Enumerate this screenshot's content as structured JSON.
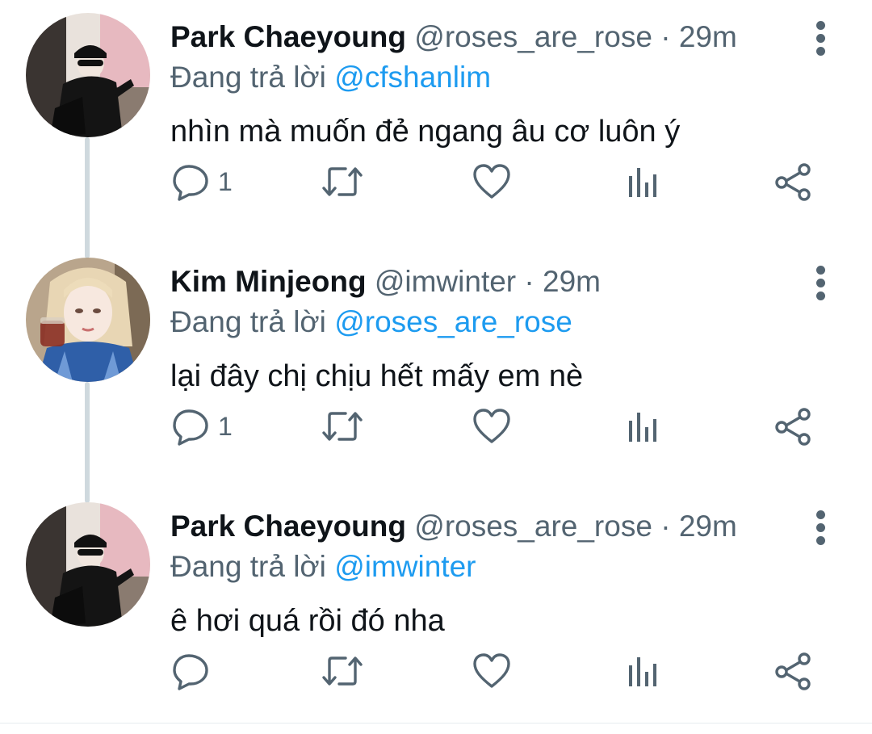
{
  "thread": [
    {
      "display_name": "Park Chaeyoung",
      "handle": "@roses_are_rose",
      "separator": "·",
      "time": "29m",
      "reply_prefix": "Đang trả lời",
      "reply_mention": "@cfshanlim",
      "text": "nhìn mà muốn đẻ ngang âu cơ luôn ý",
      "reply_count": "1",
      "avatar": "avatar-photo-black-outfit"
    },
    {
      "display_name": "Kim Minjeong",
      "handle": "@imwinter",
      "separator": "·",
      "time": "29m",
      "reply_prefix": "Đang trả lời",
      "reply_mention": "@roses_are_rose",
      "text": "lại đây chị chịu hết mấy em nè",
      "reply_count": "1",
      "avatar": "avatar-photo-blonde-blue-shirt"
    },
    {
      "display_name": "Park Chaeyoung",
      "handle": "@roses_are_rose",
      "separator": "·",
      "time": "29m",
      "reply_prefix": "Đang trả lời",
      "reply_mention": "@imwinter",
      "text": "ê hơi quá rồi đó nha",
      "reply_count": "",
      "avatar": "avatar-photo-black-outfit"
    }
  ],
  "icons": {
    "reply": "reply-bubble-icon",
    "retweet": "retweet-arrows-icon",
    "like": "heart-icon",
    "stats": "bar-stats-icon",
    "share": "share-nodes-icon",
    "more": "vertical-ellipsis-icon"
  },
  "colors": {
    "link": "#1d9bf0",
    "muted": "#536471",
    "text": "#0f1419",
    "thread_line": "#cfd9de"
  }
}
